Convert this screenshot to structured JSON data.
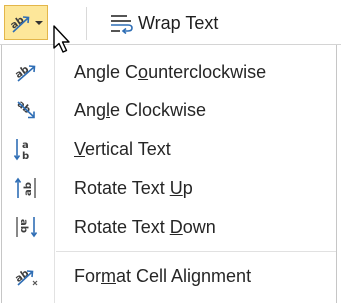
{
  "ribbon": {
    "orientation_button": {
      "icon": "text-orientation-icon",
      "dropdown_icon": "caret-down-icon"
    },
    "wrap_text": {
      "label": "Wrap Text",
      "icon": "wrap-text-icon"
    }
  },
  "menu": {
    "items": [
      {
        "id": "angle-ccw",
        "pre": "Angle C",
        "key": "o",
        "post": "unterclockwise",
        "icon": "angle-counterclockwise-icon"
      },
      {
        "id": "angle-cw",
        "pre": "Ang",
        "key": "l",
        "post": "e Clockwise",
        "icon": "angle-clockwise-icon"
      },
      {
        "id": "vertical",
        "pre": "",
        "key": "V",
        "post": "ertical Text",
        "icon": "vertical-text-icon"
      },
      {
        "id": "rotate-up",
        "pre": "Rotate Text ",
        "key": "U",
        "post": "p",
        "icon": "rotate-text-up-icon"
      },
      {
        "id": "rotate-down",
        "pre": "Rotate Text ",
        "key": "D",
        "post": "own",
        "icon": "rotate-text-down-icon"
      },
      {
        "id": "format-cell",
        "pre": "For",
        "key": "m",
        "post": "at Cell Alignment",
        "icon": "format-cell-alignment-icon"
      }
    ]
  },
  "colors": {
    "hover_fill": "#fde79a",
    "hover_border": "#e3b64a",
    "icon_blue": "#2f6eb5",
    "icon_dark": "#3d3d3d"
  }
}
